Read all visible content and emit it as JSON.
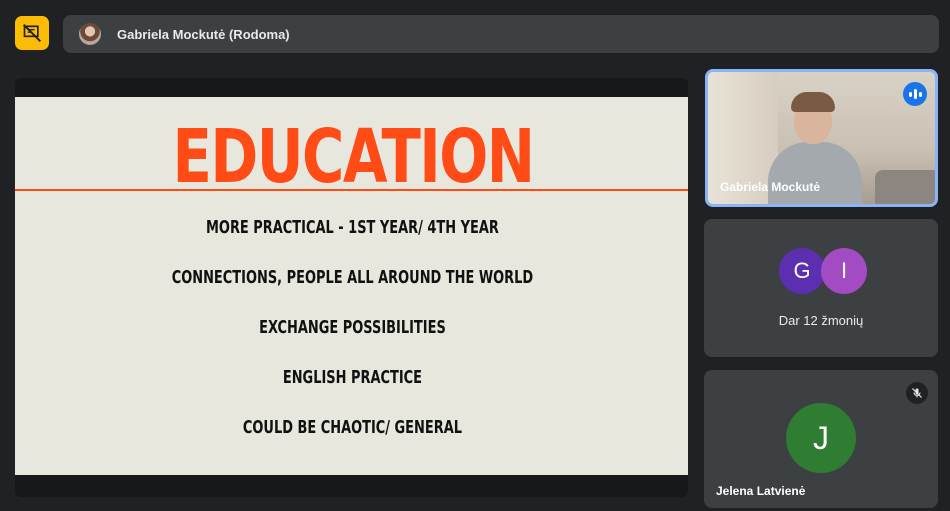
{
  "colors": {
    "accent_yellow": "#fbbc04",
    "presenter_bar": "#3c4043",
    "slide_background": "#e7e7dd",
    "slide_title": "#ff4b16",
    "active_speaker_border": "#8ab4f8",
    "avatar_g": "#5b2fb0",
    "avatar_i": "#a24bc2",
    "avatar_j": "#2e7d32"
  },
  "toolbar": {
    "present_icon": "presentation-off-icon"
  },
  "presenter_bar": {
    "label": "Gabriela Mockutė (Rodoma)"
  },
  "slide": {
    "title": "EDUCATION",
    "bullets": [
      "MORE PRACTICAL - 1ST YEAR/ 4TH YEAR",
      "CONNECTIONS, PEOPLE ALL AROUND THE WORLD",
      "EXCHANGE POSSIBILITIES",
      "ENGLISH PRACTICE",
      "COULD BE CHAOTIC/ GENERAL"
    ]
  },
  "participants": {
    "active_speaker": {
      "name": "Gabriela Mockutė",
      "indicator_icon": "speaking-indicator-icon"
    },
    "others": {
      "initials": [
        "G",
        "I"
      ],
      "label": "Dar 12 žmonių"
    },
    "jelena": {
      "initial": "J",
      "name": "Jelena Latvienė",
      "status_icon": "mic-off-icon"
    }
  }
}
